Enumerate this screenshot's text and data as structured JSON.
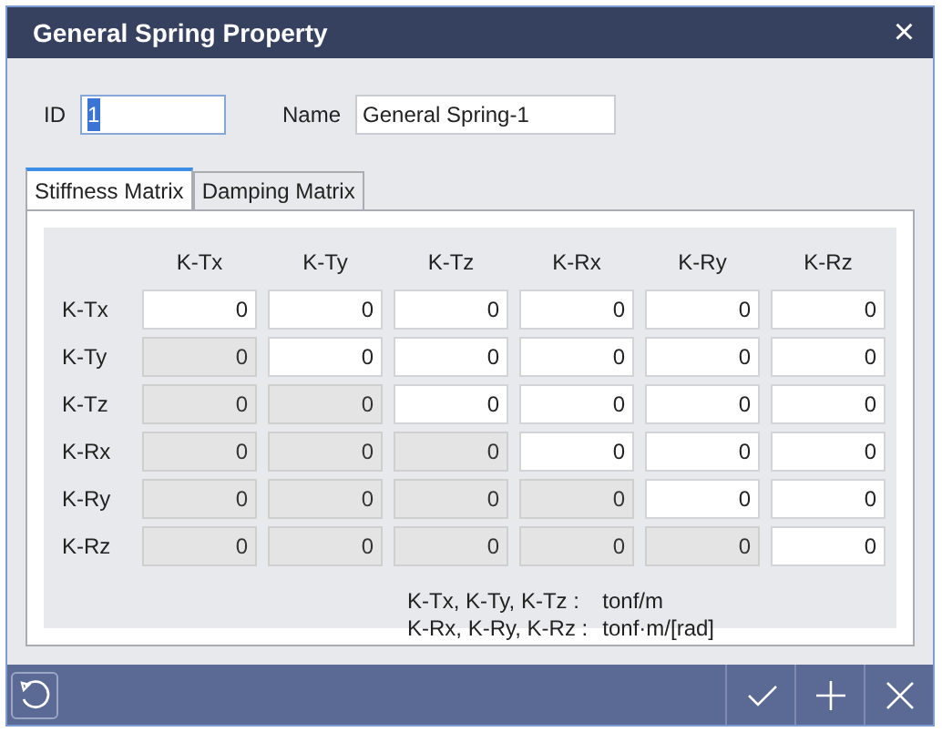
{
  "window": {
    "title": "General Spring Property",
    "close": "×"
  },
  "id_field": {
    "label": "ID",
    "value": "1",
    "text_selected": true
  },
  "name_field": {
    "label": "Name",
    "value": "General Spring-1"
  },
  "tabs": [
    {
      "label": "Stiffness Matrix",
      "selected": true
    },
    {
      "label": "Damping Matrix",
      "selected": false
    }
  ],
  "matrix": {
    "columns": [
      "K-Tx",
      "K-Ty",
      "K-Tz",
      "K-Rx",
      "K-Ry",
      "K-Rz"
    ],
    "rows": [
      {
        "label": "K-Tx",
        "cells": [
          {
            "value": "0",
            "disabled": false
          },
          {
            "value": "0",
            "disabled": false
          },
          {
            "value": "0",
            "disabled": false
          },
          {
            "value": "0",
            "disabled": false
          },
          {
            "value": "0",
            "disabled": false
          },
          {
            "value": "0",
            "disabled": false
          }
        ]
      },
      {
        "label": "K-Ty",
        "cells": [
          {
            "value": "0",
            "disabled": true
          },
          {
            "value": "0",
            "disabled": false
          },
          {
            "value": "0",
            "disabled": false
          },
          {
            "value": "0",
            "disabled": false
          },
          {
            "value": "0",
            "disabled": false
          },
          {
            "value": "0",
            "disabled": false
          }
        ]
      },
      {
        "label": "K-Tz",
        "cells": [
          {
            "value": "0",
            "disabled": true
          },
          {
            "value": "0",
            "disabled": true
          },
          {
            "value": "0",
            "disabled": false
          },
          {
            "value": "0",
            "disabled": false
          },
          {
            "value": "0",
            "disabled": false
          },
          {
            "value": "0",
            "disabled": false
          }
        ]
      },
      {
        "label": "K-Rx",
        "cells": [
          {
            "value": "0",
            "disabled": true
          },
          {
            "value": "0",
            "disabled": true
          },
          {
            "value": "0",
            "disabled": true
          },
          {
            "value": "0",
            "disabled": false
          },
          {
            "value": "0",
            "disabled": false
          },
          {
            "value": "0",
            "disabled": false
          }
        ]
      },
      {
        "label": "K-Ry",
        "cells": [
          {
            "value": "0",
            "disabled": true
          },
          {
            "value": "0",
            "disabled": true
          },
          {
            "value": "0",
            "disabled": true
          },
          {
            "value": "0",
            "disabled": true
          },
          {
            "value": "0",
            "disabled": false
          },
          {
            "value": "0",
            "disabled": false
          }
        ]
      },
      {
        "label": "K-Rz",
        "cells": [
          {
            "value": "0",
            "disabled": true
          },
          {
            "value": "0",
            "disabled": true
          },
          {
            "value": "0",
            "disabled": true
          },
          {
            "value": "0",
            "disabled": true
          },
          {
            "value": "0",
            "disabled": true
          },
          {
            "value": "0",
            "disabled": false
          }
        ]
      }
    ]
  },
  "units": [
    {
      "label": "K-Tx, K-Ty, K-Tz :",
      "unit": "tonf/m"
    },
    {
      "label": "K-Rx, K-Ry, K-Rz :",
      "unit": "tonf·m/[rad]"
    }
  ],
  "footer": {
    "buttons": [
      {
        "kind": "ok"
      },
      {
        "kind": "add"
      },
      {
        "kind": "cancel"
      }
    ]
  }
}
